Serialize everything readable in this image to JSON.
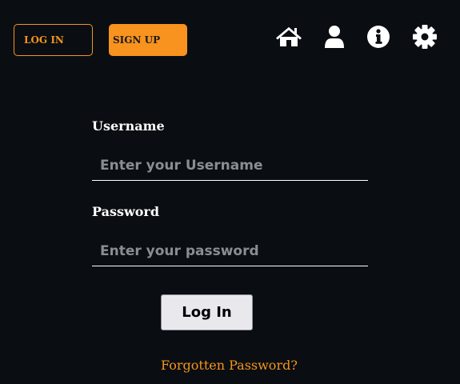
{
  "header": {
    "login_label": "LOG IN",
    "signup_label": "SIGN UP",
    "icons": [
      "home-icon",
      "user-icon",
      "info-icon",
      "settings-icon"
    ]
  },
  "form": {
    "username_label": "Username",
    "username_placeholder": "Enter your Username",
    "username_value": "",
    "password_label": "Password",
    "password_placeholder": "Enter your password",
    "password_value": "",
    "submit_label": "Log In",
    "forgot_label": "Forgotten Password?"
  },
  "colors": {
    "background": "#0a0e12",
    "accent": "#f7931e",
    "text": "#ffffff",
    "placeholder": "#8a8e92",
    "button_bg": "#e9e9ed"
  }
}
